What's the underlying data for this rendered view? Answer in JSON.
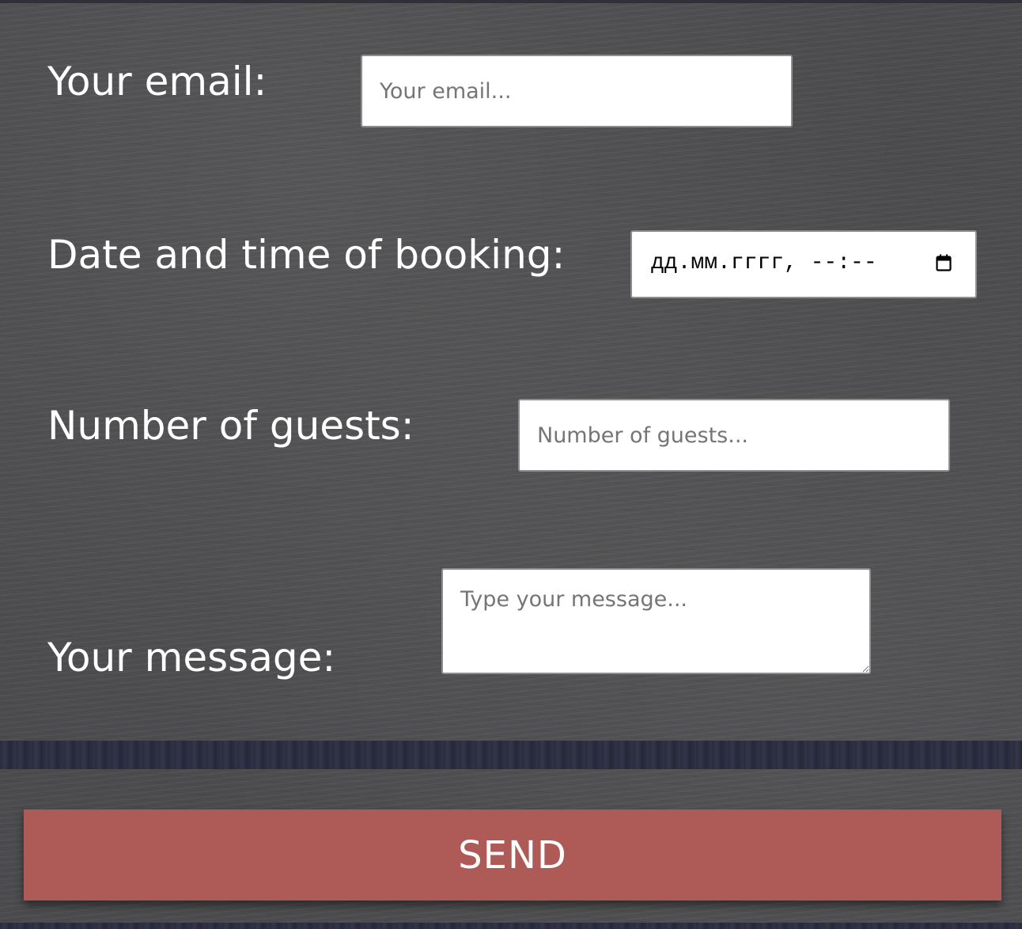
{
  "form": {
    "email": {
      "label": "Your email:",
      "placeholder": "Your email..."
    },
    "datetime": {
      "label": "Date and time of booking:",
      "display": "дд.мм.гггг, --:--",
      "icon": "calendar-icon"
    },
    "guests": {
      "label": "Number of guests:",
      "placeholder": "Number of guests..."
    },
    "message": {
      "label": "Your message:",
      "placeholder": "Type your message..."
    },
    "submit_label": "SEND"
  },
  "colors": {
    "background": "#4b4b4d",
    "button": "#ae5b58",
    "label_text": "#ffffff"
  }
}
